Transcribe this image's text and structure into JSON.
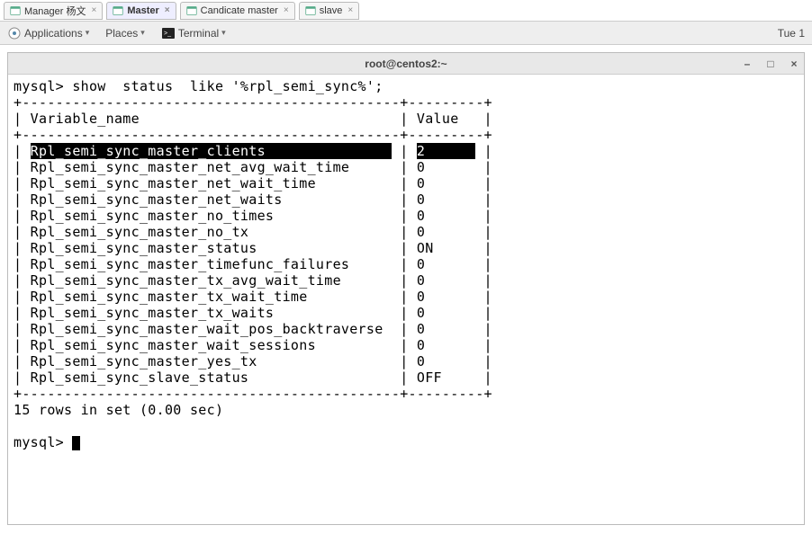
{
  "tabs": [
    {
      "label": "Manager 杨文",
      "active": false
    },
    {
      "label": "Master",
      "active": true
    },
    {
      "label": "Candicate master",
      "active": false
    },
    {
      "label": "slave",
      "active": false
    }
  ],
  "menu": {
    "applications": "Applications",
    "places": "Places",
    "terminal": "Terminal",
    "clock": "Tue 1"
  },
  "window": {
    "title": "root@centos2:~"
  },
  "terminal": {
    "prompt1": "mysql> ",
    "command": "show  status  like '%rpl_semi_sync%';",
    "border_top": "+---------------------------------------------+---------+",
    "header_line": "| Variable_name                               | Value   |",
    "rows": [
      {
        "name": "Rpl_semi_sync_master_clients",
        "value": "2",
        "highlighted": true
      },
      {
        "name": "Rpl_semi_sync_master_net_avg_wait_time",
        "value": "0"
      },
      {
        "name": "Rpl_semi_sync_master_net_wait_time",
        "value": "0"
      },
      {
        "name": "Rpl_semi_sync_master_net_waits",
        "value": "0"
      },
      {
        "name": "Rpl_semi_sync_master_no_times",
        "value": "0"
      },
      {
        "name": "Rpl_semi_sync_master_no_tx",
        "value": "0"
      },
      {
        "name": "Rpl_semi_sync_master_status",
        "value": "ON"
      },
      {
        "name": "Rpl_semi_sync_master_timefunc_failures",
        "value": "0"
      },
      {
        "name": "Rpl_semi_sync_master_tx_avg_wait_time",
        "value": "0"
      },
      {
        "name": "Rpl_semi_sync_master_tx_wait_time",
        "value": "0"
      },
      {
        "name": "Rpl_semi_sync_master_tx_waits",
        "value": "0"
      },
      {
        "name": "Rpl_semi_sync_master_wait_pos_backtraverse",
        "value": "0"
      },
      {
        "name": "Rpl_semi_sync_master_wait_sessions",
        "value": "0"
      },
      {
        "name": "Rpl_semi_sync_master_yes_tx",
        "value": "0"
      },
      {
        "name": "Rpl_semi_sync_slave_status",
        "value": "OFF"
      }
    ],
    "name_col_width": 43,
    "value_col_width": 7,
    "footer": "15 rows in set (0.00 sec)",
    "prompt2": "mysql> "
  }
}
